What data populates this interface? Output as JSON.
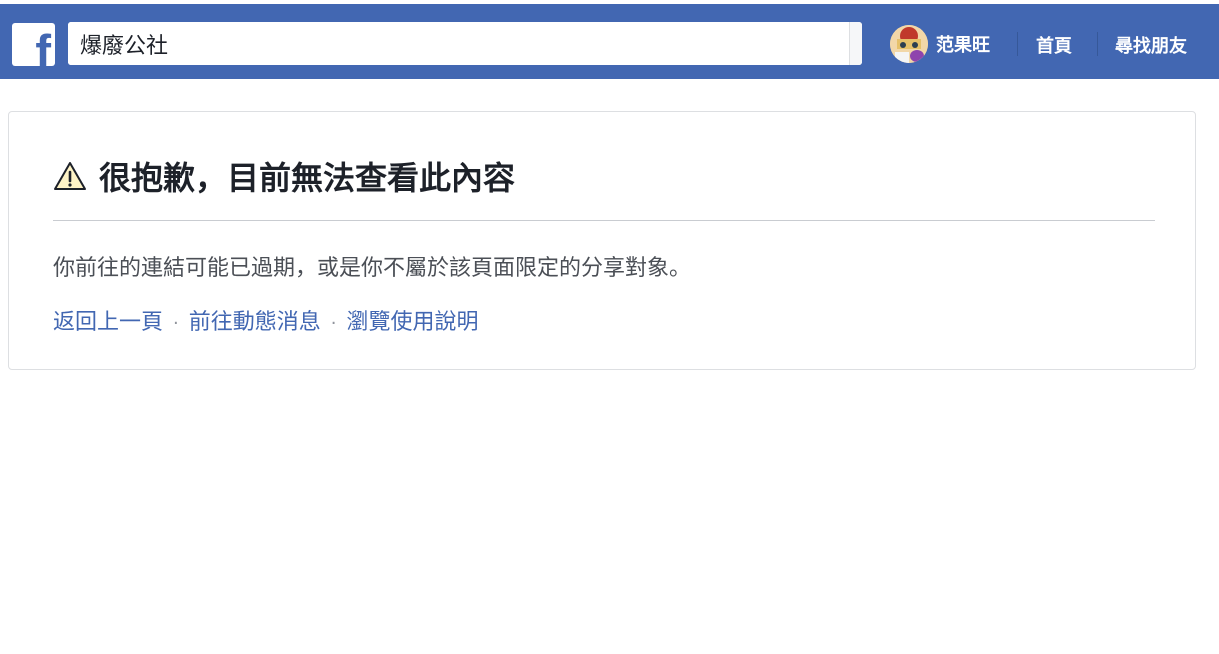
{
  "header": {
    "logo_letter": "f",
    "search": {
      "value": "爆廢公社"
    },
    "profile_name": "范果旺",
    "nav_home": "首頁",
    "nav_find_friends": "尋找朋友",
    "colors": {
      "bar": "#4267b2",
      "text": "#ffffff"
    }
  },
  "error": {
    "icon": "warning-icon",
    "title": "很抱歉，目前無法查看此內容",
    "message": "你前往的連結可能已過期，或是你不屬於該頁面限定的分享對象。",
    "links": [
      {
        "label": "返回上一頁"
      },
      {
        "label": "前往動態消息"
      },
      {
        "label": "瀏覽使用說明"
      }
    ],
    "separator": "·"
  }
}
